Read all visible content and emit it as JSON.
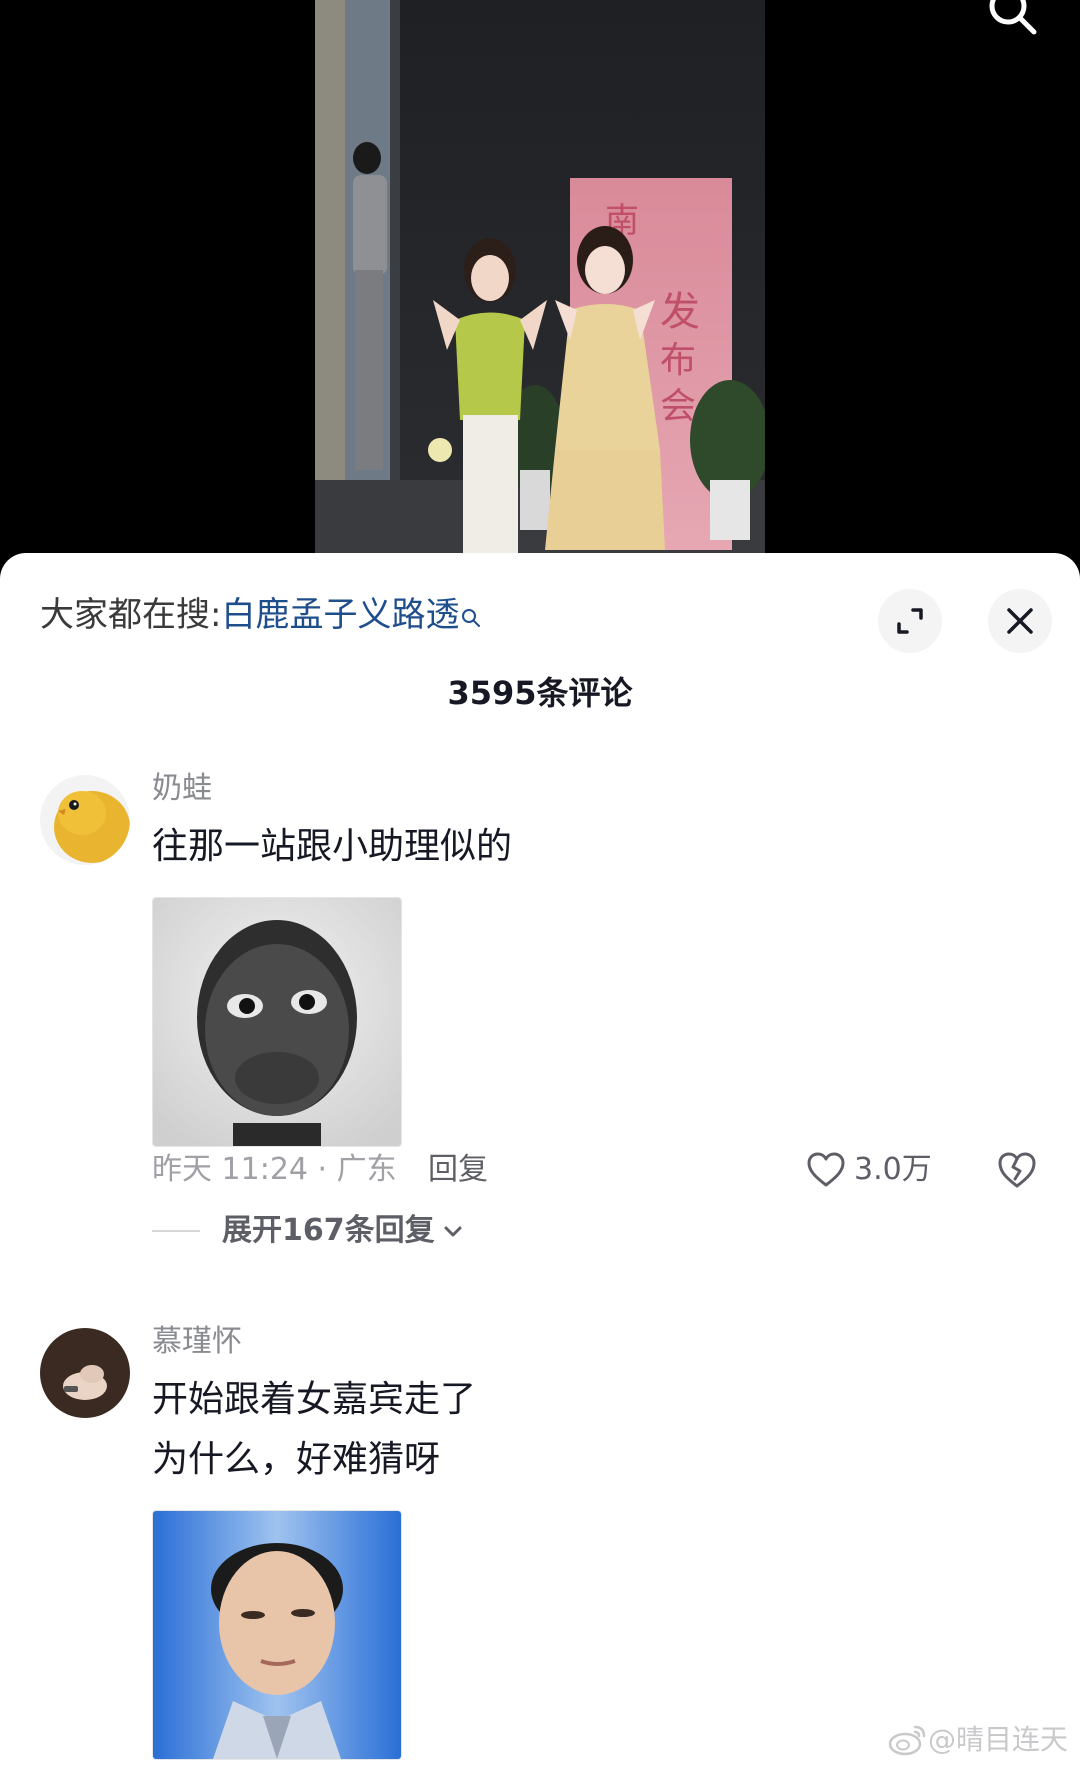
{
  "header": {
    "trending_prefix": "大家都在搜:",
    "trending_keyword": "白鹿孟子义路透",
    "comment_count": "3595条评论"
  },
  "comments": [
    {
      "username": "奶蛙",
      "text": [
        "往那一站跟小助理似的"
      ],
      "time_location": "昨天 11:24 · 广东",
      "reply_label": "回复",
      "likes": "3.0万",
      "expand_label": "展开167条回复"
    },
    {
      "username": "慕瑾怀",
      "text": [
        "开始跟着女嘉宾走了",
        "为什么，好难猜呀"
      ]
    }
  ],
  "watermark": "@晴目连天",
  "icons": {
    "search": "search-icon",
    "keyword_search": "search-icon",
    "expand": "expand-icon",
    "close": "close-icon",
    "like": "heart-icon",
    "dislike": "broken-heart-icon",
    "chevron": "chevron-down-icon",
    "weibo": "weibo-logo-icon"
  }
}
